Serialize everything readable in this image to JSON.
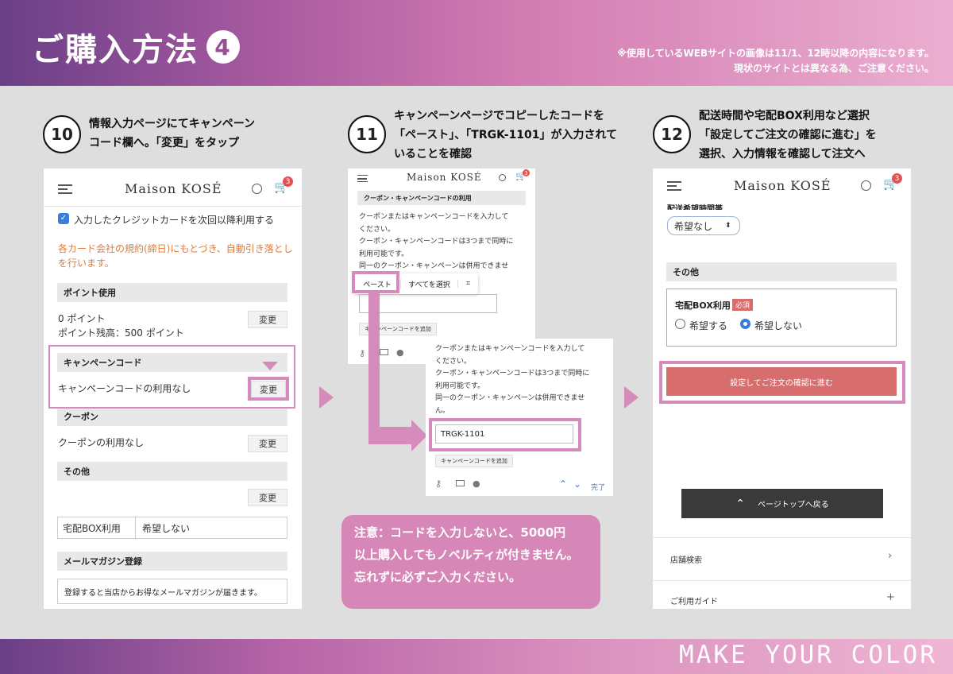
{
  "header": {
    "title": "ご購入方法",
    "step_number": "4",
    "note_line1": "※使用しているWEBサイトの画像は11/1、12時以降の内容になります。",
    "note_line2": "現状のサイトとは異なる為、ご注意ください。"
  },
  "footer": {
    "brand": "MAKE YOUR COLOR"
  },
  "step10": {
    "number": "10",
    "line1": "情報入力ページにてキャンペーン",
    "line2": "コード欄へ。「変更」をタップ"
  },
  "step11": {
    "number": "11",
    "line1": "キャンペーンページでコピーしたコードを",
    "line2": "「ペースト」、「TRGK-1101」が入力されて",
    "line3": "いることを確認"
  },
  "step12": {
    "number": "12",
    "line1": "配送時間や宅配BOX利用など選択",
    "line2": "「設定してご注文の確認に進む」を",
    "line3": "選択、入力情報を確認して注文へ"
  },
  "phone1": {
    "logo": "Maison KOSÉ",
    "cart_count": "3",
    "checkbox_label": "入力したクレジットカードを次回以降利用する",
    "orange_line1": "各カード会社の規約(締日)にもとづき、自動引き落とし",
    "orange_line2": "を行います。",
    "points_section": "ポイント使用",
    "points_value": "0 ポイント",
    "points_balance": "ポイント残高：500 ポイント",
    "change_label": "変更",
    "campaign_section": "キャンペーンコード",
    "campaign_value": "キャンペーンコードの利用なし",
    "coupon_section": "クーポン",
    "coupon_value": "クーポンの利用なし",
    "other_section": "その他",
    "box_label": "宅配BOX利用",
    "box_value": "希望しない",
    "mail_section": "メールマガジン登録",
    "mail_value": "登録すると当店からお得なメールマガジンが届きます。"
  },
  "phone2a": {
    "logo": "Maison KOSÉ",
    "cart_count": "3",
    "section": "クーポン・キャンペーンコードの利用",
    "desc1": "クーポンまたはキャンペーンコードを入力して",
    "desc2": "ください。",
    "desc3": "クーポン・キャンペーンコードは3つまで同時に",
    "desc4": "利用可能です。",
    "desc5": "同一のクーポン・キャンペーンは併用できませ",
    "paste": "ペースト",
    "select_all": "すべてを選択",
    "add_btn": "キャンペーンコードを追加"
  },
  "phone2b": {
    "desc1": "クーポンまたはキャンペーンコードを入力して",
    "desc2": "ください。",
    "desc3": "クーポン・キャンペーンコードは3つまで同時に",
    "desc4": "利用可能です。",
    "desc5": "同一のクーポン・キャンペーンは併用できませ",
    "desc6": "ん。",
    "code_value": "TRGK-1101",
    "add_btn": "キャンペーンコードを追加",
    "done": "完了"
  },
  "notice": {
    "line1": "注意：コードを入力しないと、5000円",
    "line2": "以上購入してもノベルティが付きません。",
    "line3": "忘れずに必ずご入力ください。"
  },
  "phone3": {
    "logo": "Maison KOSÉ",
    "cart_count": "3",
    "delivery_label": "配送希望時間帯",
    "delivery_value": "希望なし",
    "other_section": "その他",
    "box_label": "宅配BOX利用",
    "required": "必須",
    "opt_yes": "希望する",
    "opt_no": "希望しない",
    "proceed_btn": "設定してご注文の確認に進む",
    "page_top": "ページトップへ戻る",
    "store_search": "店舗検索",
    "guide": "ご利用ガイド"
  },
  "colors": {
    "accent_pink": "#d58bbc",
    "proceed_red": "#d76d6d",
    "dark_button": "#3a3a3a"
  }
}
